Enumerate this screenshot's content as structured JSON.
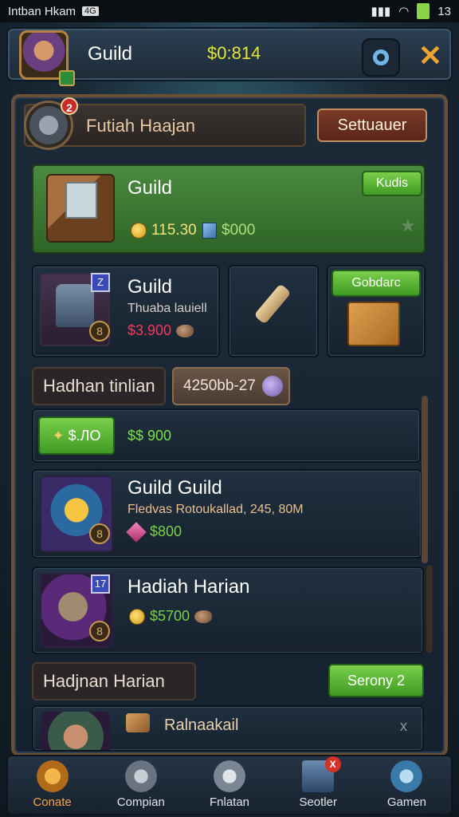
{
  "status_bar": {
    "left_text": "Intban Hkam",
    "badge": "4G",
    "right_text": "13"
  },
  "top_bar": {
    "title": "Guild",
    "money": "$0:814"
  },
  "header": {
    "badge": "2",
    "title": "Futiah Haajan",
    "settings_label": "Settuauer"
  },
  "guild_card": {
    "title": "Guild",
    "tag": "Kudis",
    "gold": "115.30",
    "gems": "$000",
    "star": "★"
  },
  "item_cards": {
    "left": {
      "title": "Guild",
      "subtitle": "Thuaba lauiell",
      "price": "$3.900",
      "badge": "Z",
      "level": "8"
    },
    "right_tag": "Gobdarc"
  },
  "section1": {
    "label": "Hadhan tinlian",
    "pill": "4250bb-27"
  },
  "green_row": {
    "tag": "$.ЛО",
    "value": "$$ 900"
  },
  "list_items": [
    {
      "title": "Guild Guild",
      "subtitle": "Fledvas Rotoukallad, 245, 80M",
      "value": "$800",
      "badge": "8"
    },
    {
      "title": "Hadiah Harian",
      "subtitle": "",
      "value": "$5700",
      "badge": "8",
      "top_badge": "17"
    }
  ],
  "section2": {
    "label": "Hadjnan Harian",
    "button": "Serony 2"
  },
  "last_item": {
    "title": "Ralnaakail",
    "close": "x"
  },
  "bottom_nav": [
    {
      "label": "Conate"
    },
    {
      "label": "Compian"
    },
    {
      "label": "Fnlatan"
    },
    {
      "label": "Seotler",
      "badge": "X"
    },
    {
      "label": "Gamen"
    }
  ],
  "colors": {
    "gold": "#e4e63a",
    "green": "#4b8a3e",
    "accent": "#f2a24a",
    "red": "#c92a2a"
  }
}
